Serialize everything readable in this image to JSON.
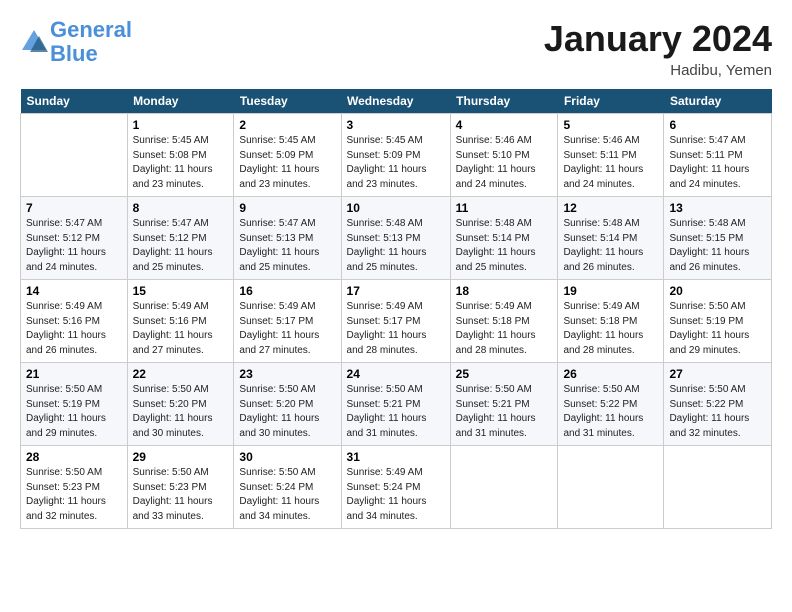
{
  "logo": {
    "line1": "General",
    "line2": "Blue"
  },
  "title": "January 2024",
  "subtitle": "Hadibu, Yemen",
  "headers": [
    "Sunday",
    "Monday",
    "Tuesday",
    "Wednesday",
    "Thursday",
    "Friday",
    "Saturday"
  ],
  "weeks": [
    [
      {
        "num": "",
        "info": ""
      },
      {
        "num": "1",
        "info": "Sunrise: 5:45 AM\nSunset: 5:08 PM\nDaylight: 11 hours\nand 23 minutes."
      },
      {
        "num": "2",
        "info": "Sunrise: 5:45 AM\nSunset: 5:09 PM\nDaylight: 11 hours\nand 23 minutes."
      },
      {
        "num": "3",
        "info": "Sunrise: 5:45 AM\nSunset: 5:09 PM\nDaylight: 11 hours\nand 23 minutes."
      },
      {
        "num": "4",
        "info": "Sunrise: 5:46 AM\nSunset: 5:10 PM\nDaylight: 11 hours\nand 24 minutes."
      },
      {
        "num": "5",
        "info": "Sunrise: 5:46 AM\nSunset: 5:11 PM\nDaylight: 11 hours\nand 24 minutes."
      },
      {
        "num": "6",
        "info": "Sunrise: 5:47 AM\nSunset: 5:11 PM\nDaylight: 11 hours\nand 24 minutes."
      }
    ],
    [
      {
        "num": "7",
        "info": "Sunrise: 5:47 AM\nSunset: 5:12 PM\nDaylight: 11 hours\nand 24 minutes."
      },
      {
        "num": "8",
        "info": "Sunrise: 5:47 AM\nSunset: 5:12 PM\nDaylight: 11 hours\nand 25 minutes."
      },
      {
        "num": "9",
        "info": "Sunrise: 5:47 AM\nSunset: 5:13 PM\nDaylight: 11 hours\nand 25 minutes."
      },
      {
        "num": "10",
        "info": "Sunrise: 5:48 AM\nSunset: 5:13 PM\nDaylight: 11 hours\nand 25 minutes."
      },
      {
        "num": "11",
        "info": "Sunrise: 5:48 AM\nSunset: 5:14 PM\nDaylight: 11 hours\nand 25 minutes."
      },
      {
        "num": "12",
        "info": "Sunrise: 5:48 AM\nSunset: 5:14 PM\nDaylight: 11 hours\nand 26 minutes."
      },
      {
        "num": "13",
        "info": "Sunrise: 5:48 AM\nSunset: 5:15 PM\nDaylight: 11 hours\nand 26 minutes."
      }
    ],
    [
      {
        "num": "14",
        "info": "Sunrise: 5:49 AM\nSunset: 5:16 PM\nDaylight: 11 hours\nand 26 minutes."
      },
      {
        "num": "15",
        "info": "Sunrise: 5:49 AM\nSunset: 5:16 PM\nDaylight: 11 hours\nand 27 minutes."
      },
      {
        "num": "16",
        "info": "Sunrise: 5:49 AM\nSunset: 5:17 PM\nDaylight: 11 hours\nand 27 minutes."
      },
      {
        "num": "17",
        "info": "Sunrise: 5:49 AM\nSunset: 5:17 PM\nDaylight: 11 hours\nand 28 minutes."
      },
      {
        "num": "18",
        "info": "Sunrise: 5:49 AM\nSunset: 5:18 PM\nDaylight: 11 hours\nand 28 minutes."
      },
      {
        "num": "19",
        "info": "Sunrise: 5:49 AM\nSunset: 5:18 PM\nDaylight: 11 hours\nand 28 minutes."
      },
      {
        "num": "20",
        "info": "Sunrise: 5:50 AM\nSunset: 5:19 PM\nDaylight: 11 hours\nand 29 minutes."
      }
    ],
    [
      {
        "num": "21",
        "info": "Sunrise: 5:50 AM\nSunset: 5:19 PM\nDaylight: 11 hours\nand 29 minutes."
      },
      {
        "num": "22",
        "info": "Sunrise: 5:50 AM\nSunset: 5:20 PM\nDaylight: 11 hours\nand 30 minutes."
      },
      {
        "num": "23",
        "info": "Sunrise: 5:50 AM\nSunset: 5:20 PM\nDaylight: 11 hours\nand 30 minutes."
      },
      {
        "num": "24",
        "info": "Sunrise: 5:50 AM\nSunset: 5:21 PM\nDaylight: 11 hours\nand 31 minutes."
      },
      {
        "num": "25",
        "info": "Sunrise: 5:50 AM\nSunset: 5:21 PM\nDaylight: 11 hours\nand 31 minutes."
      },
      {
        "num": "26",
        "info": "Sunrise: 5:50 AM\nSunset: 5:22 PM\nDaylight: 11 hours\nand 31 minutes."
      },
      {
        "num": "27",
        "info": "Sunrise: 5:50 AM\nSunset: 5:22 PM\nDaylight: 11 hours\nand 32 minutes."
      }
    ],
    [
      {
        "num": "28",
        "info": "Sunrise: 5:50 AM\nSunset: 5:23 PM\nDaylight: 11 hours\nand 32 minutes."
      },
      {
        "num": "29",
        "info": "Sunrise: 5:50 AM\nSunset: 5:23 PM\nDaylight: 11 hours\nand 33 minutes."
      },
      {
        "num": "30",
        "info": "Sunrise: 5:50 AM\nSunset: 5:24 PM\nDaylight: 11 hours\nand 34 minutes."
      },
      {
        "num": "31",
        "info": "Sunrise: 5:49 AM\nSunset: 5:24 PM\nDaylight: 11 hours\nand 34 minutes."
      },
      {
        "num": "",
        "info": ""
      },
      {
        "num": "",
        "info": ""
      },
      {
        "num": "",
        "info": ""
      }
    ]
  ]
}
